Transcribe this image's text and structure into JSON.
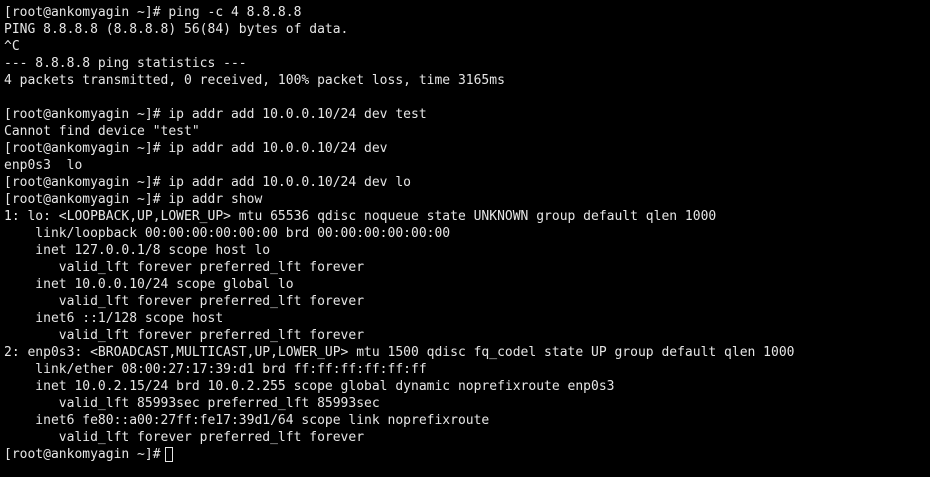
{
  "terminal": {
    "lines": [
      "[root@ankomyagin ~]# ping -c 4 8.8.8.8",
      "PING 8.8.8.8 (8.8.8.8) 56(84) bytes of data.",
      "^C",
      "--- 8.8.8.8 ping statistics ---",
      "4 packets transmitted, 0 received, 100% packet loss, time 3165ms",
      "",
      "[root@ankomyagin ~]# ip addr add 10.0.0.10/24 dev test",
      "Cannot find device \"test\"",
      "[root@ankomyagin ~]# ip addr add 10.0.0.10/24 dev",
      "enp0s3  lo",
      "[root@ankomyagin ~]# ip addr add 10.0.0.10/24 dev lo",
      "[root@ankomyagin ~]# ip addr show",
      "1: lo: <LOOPBACK,UP,LOWER_UP> mtu 65536 qdisc noqueue state UNKNOWN group default qlen 1000",
      "    link/loopback 00:00:00:00:00:00 brd 00:00:00:00:00:00",
      "    inet 127.0.0.1/8 scope host lo",
      "       valid_lft forever preferred_lft forever",
      "    inet 10.0.0.10/24 scope global lo",
      "       valid_lft forever preferred_lft forever",
      "    inet6 ::1/128 scope host",
      "       valid_lft forever preferred_lft forever",
      "2: enp0s3: <BROADCAST,MULTICAST,UP,LOWER_UP> mtu 1500 qdisc fq_codel state UP group default qlen 1000",
      "    link/ether 08:00:27:17:39:d1 brd ff:ff:ff:ff:ff:ff",
      "    inet 10.0.2.15/24 brd 10.0.2.255 scope global dynamic noprefixroute enp0s3",
      "       valid_lft 85993sec preferred_lft 85993sec",
      "    inet6 fe80::a00:27ff:fe17:39d1/64 scope link noprefixroute",
      "       valid_lft forever preferred_lft forever"
    ],
    "current_prompt": "[root@ankomyagin ~]#",
    "colors": {
      "background": "#000000",
      "foreground": "#e6e6e6"
    }
  }
}
